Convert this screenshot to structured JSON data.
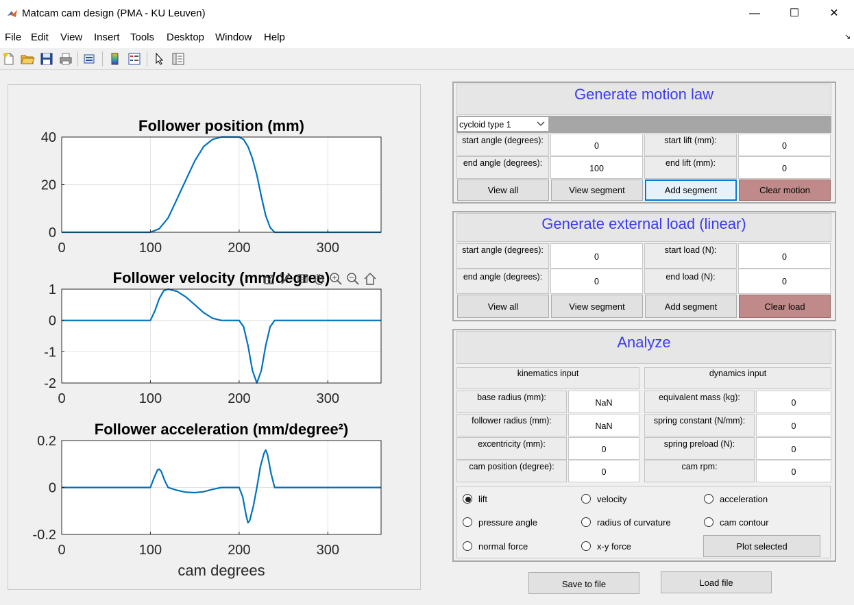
{
  "window": {
    "title": "Matcam cam design (PMA - KU Leuven)",
    "minimize": "—",
    "maximize": "☐",
    "close": "✕"
  },
  "menu": [
    "File",
    "Edit",
    "View",
    "Insert",
    "Tools",
    "Desktop",
    "Window",
    "Help"
  ],
  "toolbar": {
    "icons": [
      "new-file-icon",
      "open-folder-icon",
      "save-icon",
      "print-icon",
      "print-preview-icon",
      "colorbar-icon",
      "legend-icon",
      "pointer-icon",
      "property-inspector-icon"
    ]
  },
  "axes_toolbar": {
    "icons": [
      "export-icon",
      "brush-icon",
      "data-tip-icon",
      "pan-icon",
      "zoom-in-icon",
      "zoom-out-icon",
      "home-icon"
    ]
  },
  "motion": {
    "title": "Generate motion law",
    "dropdown_value": "cycloid type 1",
    "start_angle_label": "start angle (degrees):",
    "start_angle_value": "0",
    "end_angle_label": "end angle (degrees):",
    "end_angle_value": "100",
    "start_lift_label": "start lift (mm):",
    "start_lift_value": "0",
    "end_lift_label": "end lift (mm):",
    "end_lift_value": "0",
    "view_all": "View all",
    "view_segment": "View segment",
    "add_segment": "Add segment",
    "clear": "Clear motion"
  },
  "load": {
    "title": "Generate external load (linear)",
    "start_angle_label": "start angle (degrees):",
    "start_angle_value": "0",
    "end_angle_label": "end angle (degrees):",
    "end_angle_value": "0",
    "start_load_label": "start load (N):",
    "start_load_value": "0",
    "end_load_label": "end load (N):",
    "end_load_value": "0",
    "view_all": "View all",
    "view_segment": "View segment",
    "add_segment": "Add segment",
    "clear": "Clear load"
  },
  "analyze": {
    "title": "Analyze",
    "kin_header": "kinematics input",
    "dyn_header": "dynamics input",
    "kin": [
      {
        "label": "base radius (mm):",
        "value": "NaN"
      },
      {
        "label": "follower radius (mm):",
        "value": "NaN"
      },
      {
        "label": "excentricity (mm):",
        "value": "0"
      },
      {
        "label": "cam position (degree):",
        "value": "0"
      }
    ],
    "dyn": [
      {
        "label": "equivalent mass (kg):",
        "value": "0"
      },
      {
        "label": "spring constant (N/mm):",
        "value": "0"
      },
      {
        "label": "spring preload (N):",
        "value": "0"
      },
      {
        "label": "cam rpm:",
        "value": "0"
      }
    ],
    "radios": {
      "lift": "lift",
      "velocity": "velocity",
      "acceleration": "acceleration",
      "pressure_angle": "pressure angle",
      "radius_of_curvature": "radius of curvature",
      "cam_contour": "cam contour",
      "normal_force": "normal force",
      "xy_force": "x-y force"
    },
    "selected_radio": "lift",
    "plot_selected": "Plot selected"
  },
  "file_buttons": {
    "save": "Save to file",
    "load": "Load file"
  },
  "colors": {
    "plot_line": "#0072bd",
    "panel_title": "#3b3bf0",
    "clear_button": "#c08a8a"
  },
  "chart_data": [
    {
      "type": "line",
      "title": "Follower position (mm)",
      "xlabel": "",
      "ylabel": "",
      "xlim": [
        0,
        360
      ],
      "ylim": [
        0,
        40
      ],
      "xticks": [
        0,
        100,
        200,
        300
      ],
      "yticks": [
        0,
        20,
        40
      ],
      "grid": true,
      "series": [
        {
          "x": [
            0,
            100,
            110,
            120,
            130,
            140,
            150,
            160,
            170,
            180,
            190,
            200,
            205,
            210,
            215,
            220,
            225,
            230,
            235,
            240,
            360
          ],
          "y": [
            0,
            0,
            1.5,
            6,
            14,
            22,
            30,
            36,
            39,
            40,
            40,
            40,
            39,
            36,
            31,
            24,
            15,
            7,
            2,
            0,
            0
          ]
        }
      ]
    },
    {
      "type": "line",
      "title": "Follower velocity (mm/degree)",
      "xlabel": "",
      "ylabel": "",
      "xlim": [
        0,
        360
      ],
      "ylim": [
        -2,
        1
      ],
      "xticks": [
        0,
        100,
        200,
        300
      ],
      "yticks": [
        -2,
        -1,
        0,
        1
      ],
      "grid": true,
      "series": [
        {
          "x": [
            0,
            100,
            105,
            110,
            115,
            120,
            130,
            140,
            150,
            160,
            170,
            180,
            200,
            205,
            210,
            215,
            220,
            225,
            230,
            235,
            240,
            360
          ],
          "y": [
            0,
            0,
            0.3,
            0.7,
            0.95,
            1.0,
            0.93,
            0.75,
            0.5,
            0.25,
            0.07,
            0,
            0,
            -0.2,
            -0.8,
            -1.6,
            -2.0,
            -1.6,
            -0.8,
            -0.2,
            0,
            0
          ]
        }
      ]
    },
    {
      "type": "line",
      "title": "Follower acceleration (mm/degree²)",
      "xlabel": "cam degrees",
      "ylabel": "",
      "xlim": [
        0,
        360
      ],
      "ylim": [
        -0.2,
        0.2
      ],
      "xticks": [
        0,
        100,
        200,
        300
      ],
      "yticks": [
        -0.2,
        0,
        0.2
      ],
      "grid": true,
      "series": [
        {
          "x": [
            0,
            100,
            104,
            108,
            110,
            112,
            116,
            120,
            130,
            140,
            150,
            160,
            170,
            180,
            200,
            204,
            208,
            210,
            212,
            216,
            220,
            224,
            228,
            230,
            232,
            236,
            240,
            360
          ],
          "y": [
            0,
            0,
            0.04,
            0.075,
            0.078,
            0.07,
            0.03,
            0,
            -0.012,
            -0.02,
            -0.022,
            -0.018,
            -0.008,
            0,
            0,
            -0.04,
            -0.12,
            -0.15,
            -0.14,
            -0.08,
            0,
            0.09,
            0.145,
            0.16,
            0.14,
            0.06,
            0,
            0
          ]
        }
      ]
    }
  ]
}
